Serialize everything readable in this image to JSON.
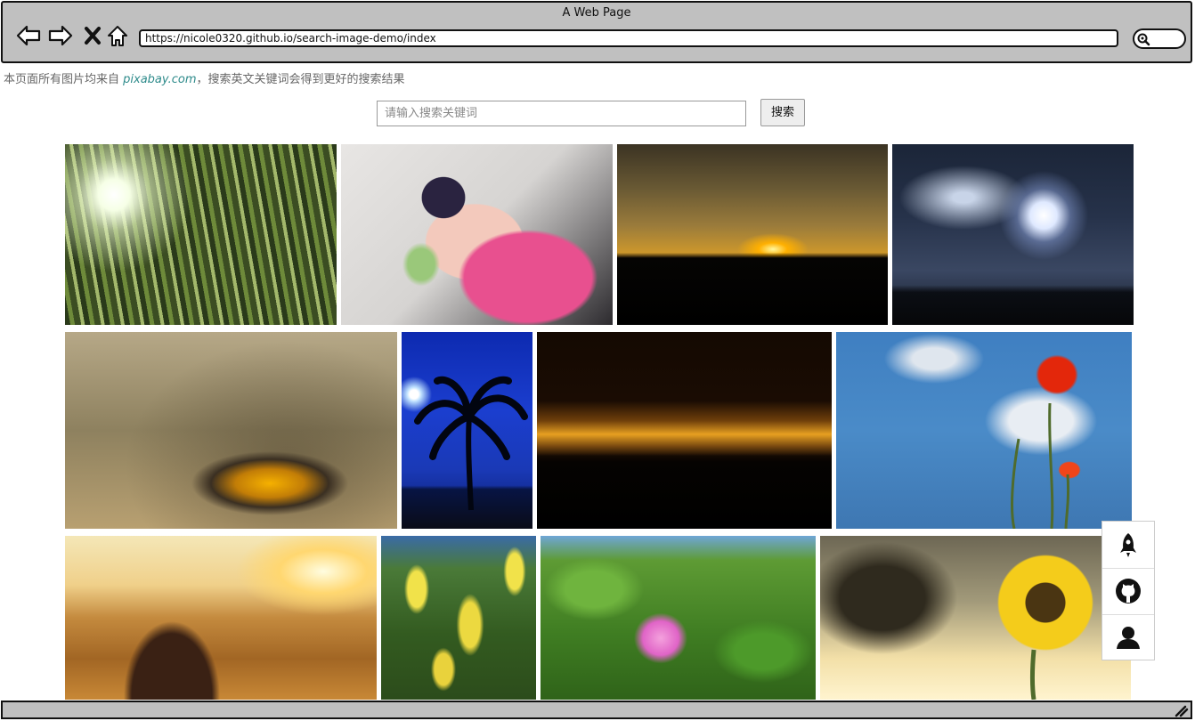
{
  "window": {
    "title": "A Web Page"
  },
  "address_bar": {
    "url": "https://nicole0320.github.io/search-image-demo/index"
  },
  "notice": {
    "prefix": "本页面所有图片均来自",
    "source": "pixabay.com",
    "suffix": "，搜索英文关键词会得到更好的搜索结果"
  },
  "search": {
    "placeholder": "请输入搜索关键词",
    "button_label": "搜索"
  },
  "icons": [
    "back-arrow-icon",
    "forward-arrow-icon",
    "close-icon",
    "home-icon",
    "search-icon",
    "rocket-icon",
    "github-icon",
    "user-icon",
    "resize-grip-icon"
  ],
  "images": [
    "bamboo-forest-photo",
    "woman-sunglasses-photo",
    "sunset-horizon-photo",
    "lightning-storm-photo",
    "cloud-sunrays-photo",
    "palm-tree-night-photo",
    "dusk-silhouette-photo",
    "red-poppy-photo",
    "girl-golden-field-photo",
    "yellow-laburnum-photo",
    "pink-wild-rose-photo",
    "sunflower-photo"
  ],
  "colors": {
    "chrome": "#c0c0c0",
    "link": "#2e8b8b"
  }
}
